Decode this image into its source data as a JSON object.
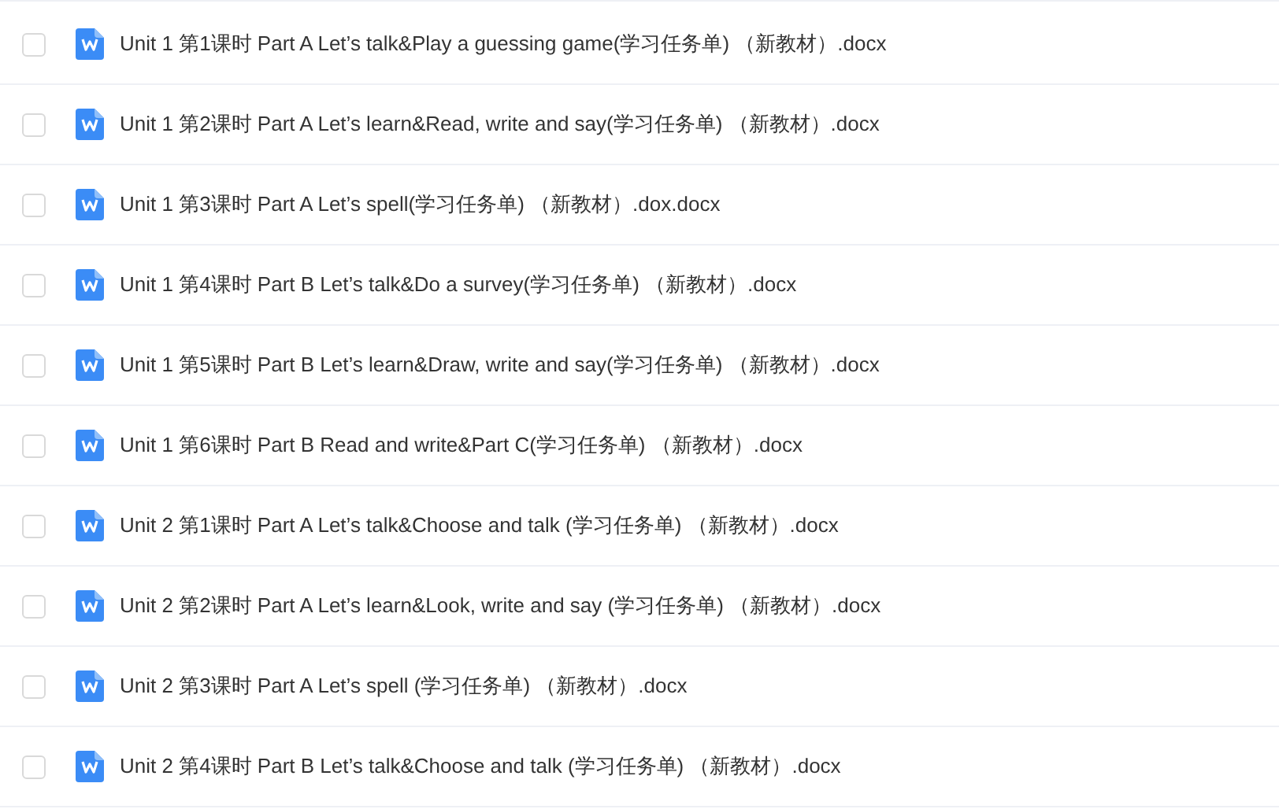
{
  "files": [
    {
      "name": "Unit 1 第1课时 Part A Let’s talk&Play a guessing game(学习任务单) （新教材）.docx",
      "checked": false
    },
    {
      "name": "Unit 1 第2课时 Part A Let’s learn&Read, write and say(学习任务单) （新教材）.docx",
      "checked": false
    },
    {
      "name": "Unit 1 第3课时 Part A Let’s spell(学习任务单) （新教材）.dox.docx",
      "checked": false
    },
    {
      "name": "Unit 1 第4课时 Part B Let’s talk&Do a survey(学习任务单) （新教材）.docx",
      "checked": false
    },
    {
      "name": "Unit 1 第5课时 Part B Let’s learn&Draw, write and say(学习任务单) （新教材）.docx",
      "checked": false
    },
    {
      "name": "Unit 1 第6课时 Part B Read and write&Part C(学习任务单) （新教材）.docx",
      "checked": false
    },
    {
      "name": "Unit 2 第1课时 Part A Let’s talk&Choose and talk (学习任务单) （新教材）.docx",
      "checked": false
    },
    {
      "name": "Unit 2 第2课时 Part A Let’s learn&Look, write and say (学习任务单) （新教材）.docx",
      "checked": false
    },
    {
      "name": "Unit 2 第3课时 Part A Let’s spell (学习任务单) （新教材）.docx",
      "checked": false
    },
    {
      "name": "Unit 2 第4课时 Part B Let’s talk&Choose and talk (学习任务单) （新教材）.docx",
      "checked": false
    }
  ]
}
